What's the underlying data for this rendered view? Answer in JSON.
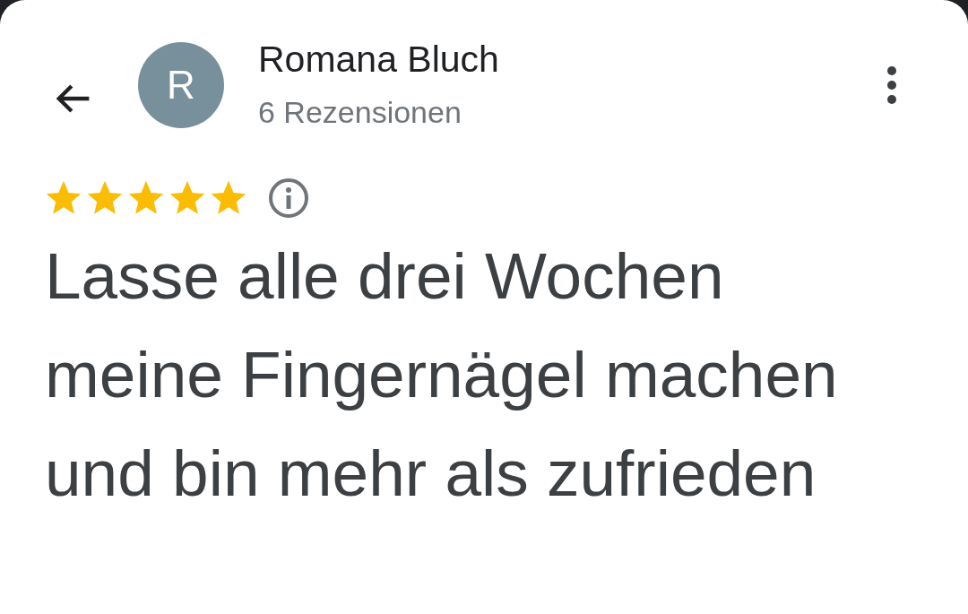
{
  "header": {
    "avatar_letter": "R",
    "name": "Romana Bluch",
    "subtitle": "6 Rezensionen"
  },
  "review": {
    "stars": 5,
    "text": "Lasse alle drei Wochen meine Fingernägel machen und bin mehr als zufrieden"
  }
}
